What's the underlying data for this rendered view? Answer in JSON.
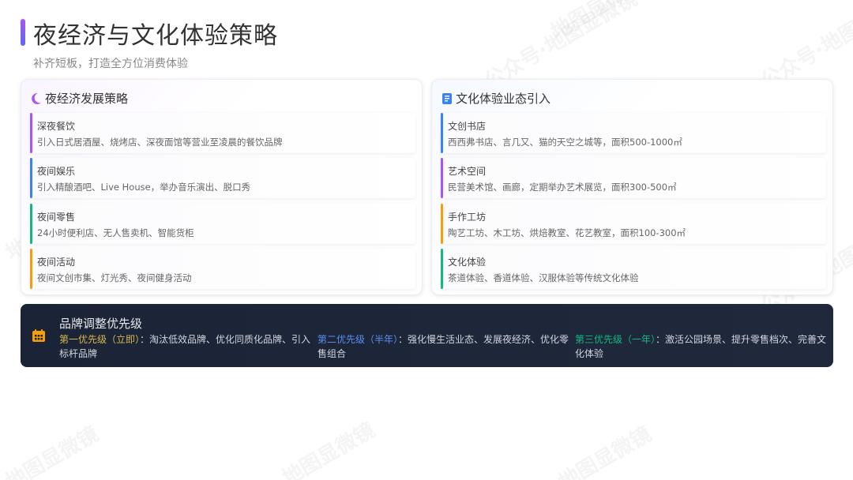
{
  "header": {
    "title": "夜经济与文化体验策略",
    "subtitle": "补齐短板，打造全方位消费体验"
  },
  "watermarks": [
    "地图显微镜",
    "公众号·地图显微镜"
  ],
  "colors": {
    "accent_purple": "#a855f7",
    "accent_blue": "#3b82f6",
    "bar_purple": "#a855f7",
    "bar_blue": "#3b82f6",
    "bar_green": "#10b981",
    "bar_orange": "#f59e0b",
    "banner_bg": "#1b2436",
    "priority1": "#d9b650",
    "priority2": "#5b8def",
    "priority3": "#10b981"
  },
  "left_panel": {
    "icon": "moon-icon",
    "title": "夜经济发展策略",
    "items": [
      {
        "name": "深夜餐饮",
        "desc": "引入日式居酒屋、烧烤店、深夜面馆等营业至凌晨的餐饮品牌",
        "color": "#a855f7"
      },
      {
        "name": "夜间娱乐",
        "desc": "引入精酿酒吧、Live House，举办音乐演出、脱口秀",
        "color": "#3b82f6"
      },
      {
        "name": "夜间零售",
        "desc": "24小时便利店、无人售卖机、智能货柜",
        "color": "#10b981"
      },
      {
        "name": "夜间活动",
        "desc": "夜间文创市集、灯光秀、夜间健身活动",
        "color": "#f59e0b"
      }
    ]
  },
  "right_panel": {
    "icon": "book-icon",
    "title": "文化体验业态引入",
    "items": [
      {
        "name": "文创书店",
        "desc": "西西弗书店、言几又、猫的天空之城等，面积500-1000㎡",
        "color": "#3b82f6"
      },
      {
        "name": "艺术空间",
        "desc": "民营美术馆、画廊，定期举办艺术展览，面积300-500㎡",
        "color": "#a855f7"
      },
      {
        "name": "手作工坊",
        "desc": "陶艺工坊、木工坊、烘焙教室、花艺教室，面积100-300㎡",
        "color": "#f59e0b"
      },
      {
        "name": "文化体验",
        "desc": "茶道体验、香道体验、汉服体验等传统文化体验",
        "color": "#10b981"
      }
    ]
  },
  "banner": {
    "icon": "calendar-icon",
    "title": "品牌调整优先级",
    "priorities": [
      {
        "label": "第一优先级（立即）",
        "sep": "：",
        "text": "淘汰低效品牌、优化同质化品牌、引入标杆品牌"
      },
      {
        "label": "第二优先级（半年）",
        "sep": "：",
        "text": "强化慢生活业态、发展夜经济、优化零售组合"
      },
      {
        "label": "第三优先级（一年）",
        "sep": "：",
        "text": "激活公园场景、提升零售档次、完善文化体验"
      }
    ]
  }
}
